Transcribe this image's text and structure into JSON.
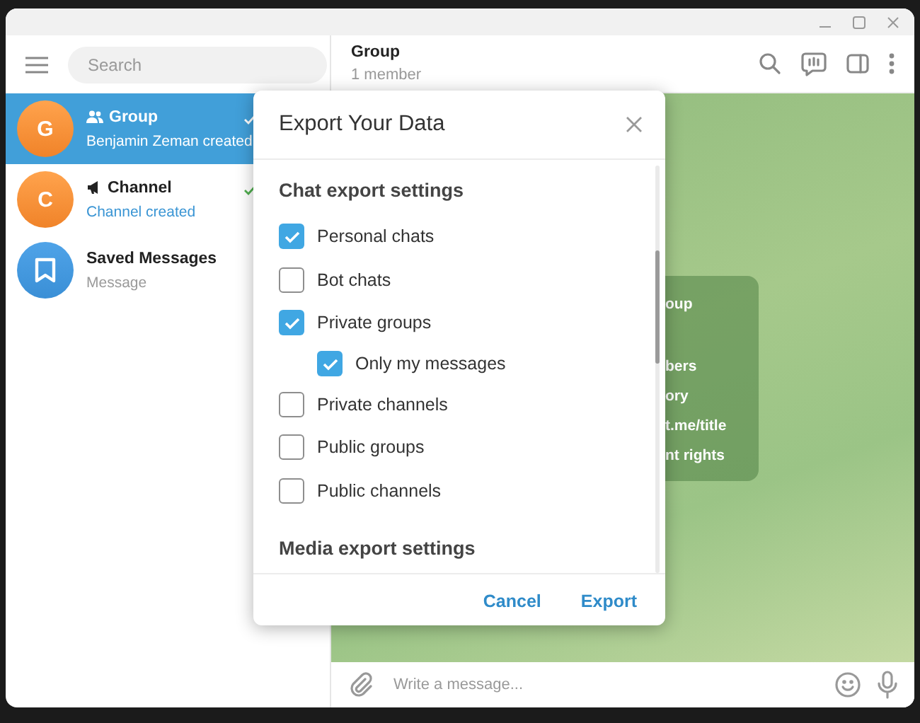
{
  "sidebar": {
    "search": {
      "placeholder": "Search"
    },
    "chats": [
      {
        "kind": "group",
        "avatar": "G",
        "name": "Group",
        "preview": "Benjamin Zeman created",
        "selected": true,
        "read": true
      },
      {
        "kind": "channel",
        "avatar": "C",
        "name": "Channel",
        "preview": "Channel created",
        "selected": false,
        "read": true
      },
      {
        "kind": "saved",
        "name": "Saved Messages",
        "preview": "Message",
        "selected": false,
        "read": false
      }
    ]
  },
  "chat": {
    "title": "Group",
    "subtitle": "1 member",
    "service_message": [
      "oup",
      "bers",
      "ory",
      "t.me/title",
      "nt rights"
    ],
    "composer": {
      "placeholder": "Write a message..."
    }
  },
  "dialog": {
    "title": "Export Your Data",
    "section": "Chat export settings",
    "options": [
      {
        "label": "Personal chats",
        "checked": true
      },
      {
        "label": "Bot chats",
        "checked": false
      },
      {
        "label": "Private groups",
        "checked": true,
        "children": [
          {
            "label": "Only my messages",
            "checked": true
          }
        ]
      },
      {
        "label": "Private channels",
        "checked": false
      },
      {
        "label": "Public groups",
        "checked": false
      },
      {
        "label": "Public channels",
        "checked": false
      }
    ],
    "next_section": "Media export settings",
    "buttons": [
      "Cancel",
      "Export"
    ]
  }
}
